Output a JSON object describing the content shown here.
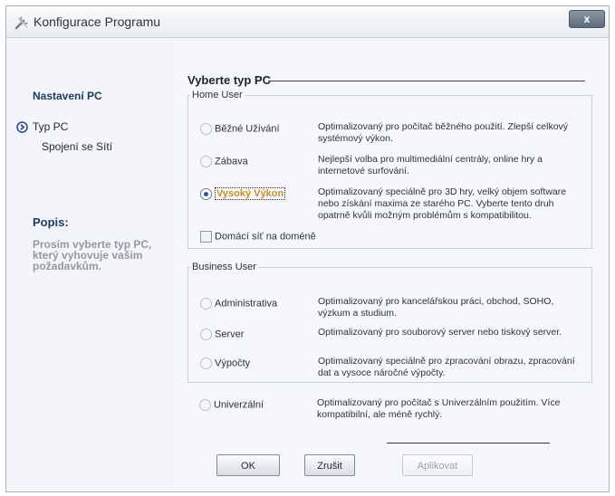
{
  "window": {
    "title": "Konfigurace Programu",
    "close_label": "x"
  },
  "sidebar": {
    "heading": "Nastavení PC",
    "items": [
      {
        "label": "Typ PC"
      },
      {
        "label": "Spojení se Sítí"
      }
    ],
    "popis_heading": "Popis:",
    "popis_text": "Prosím vyberte typ PC, který vyhovuje vašim požadavkům."
  },
  "main": {
    "title": "Vyberte typ PC",
    "home_group": {
      "legend": "Home User",
      "options": [
        {
          "label": "Běžné Užívání",
          "desc": "Optimalizovaný pro počítač běžného použití. Zlepší celkový systémový výkon.",
          "checked": false
        },
        {
          "label": "Zábava",
          "desc": "Nejlepší volba pro multimediální centrály, online hry a internetové surfování.",
          "checked": false
        },
        {
          "label": "Vysoký Výkon",
          "desc": "Optimalizovaný speciálně pro 3D hry, velký objem software nebo získání maxima ze starého PC. Vyberte tento druh opatrně kvůli možným problémům s kompatibilitou.",
          "checked": true
        }
      ],
      "checkbox_label": "Domácí síť na doméně"
    },
    "business_group": {
      "legend": "Business User",
      "options": [
        {
          "label": "Administrativa",
          "desc": "Optimalizovaný pro kancelářskou práci, obchod, SOHO, výzkum a studium.",
          "checked": false
        },
        {
          "label": "Server",
          "desc": "Optimalizovaný pro souborový server nebo tiskový server.",
          "checked": false
        },
        {
          "label": "Výpočty",
          "desc": "Optimalizovaný speciálně pro zpracování obrazu, zpracování dat a vysoce náročné výpočty.",
          "checked": false
        }
      ]
    },
    "universal": {
      "label": "Univerzální",
      "desc": "Optimalizovaný pro počítač s Univerzálním použitím. Více kompatibilní, ale méně rychlý.",
      "checked": false
    }
  },
  "buttons": {
    "ok": "OK",
    "cancel": "Zrušit",
    "apply": "Aplikovat"
  }
}
